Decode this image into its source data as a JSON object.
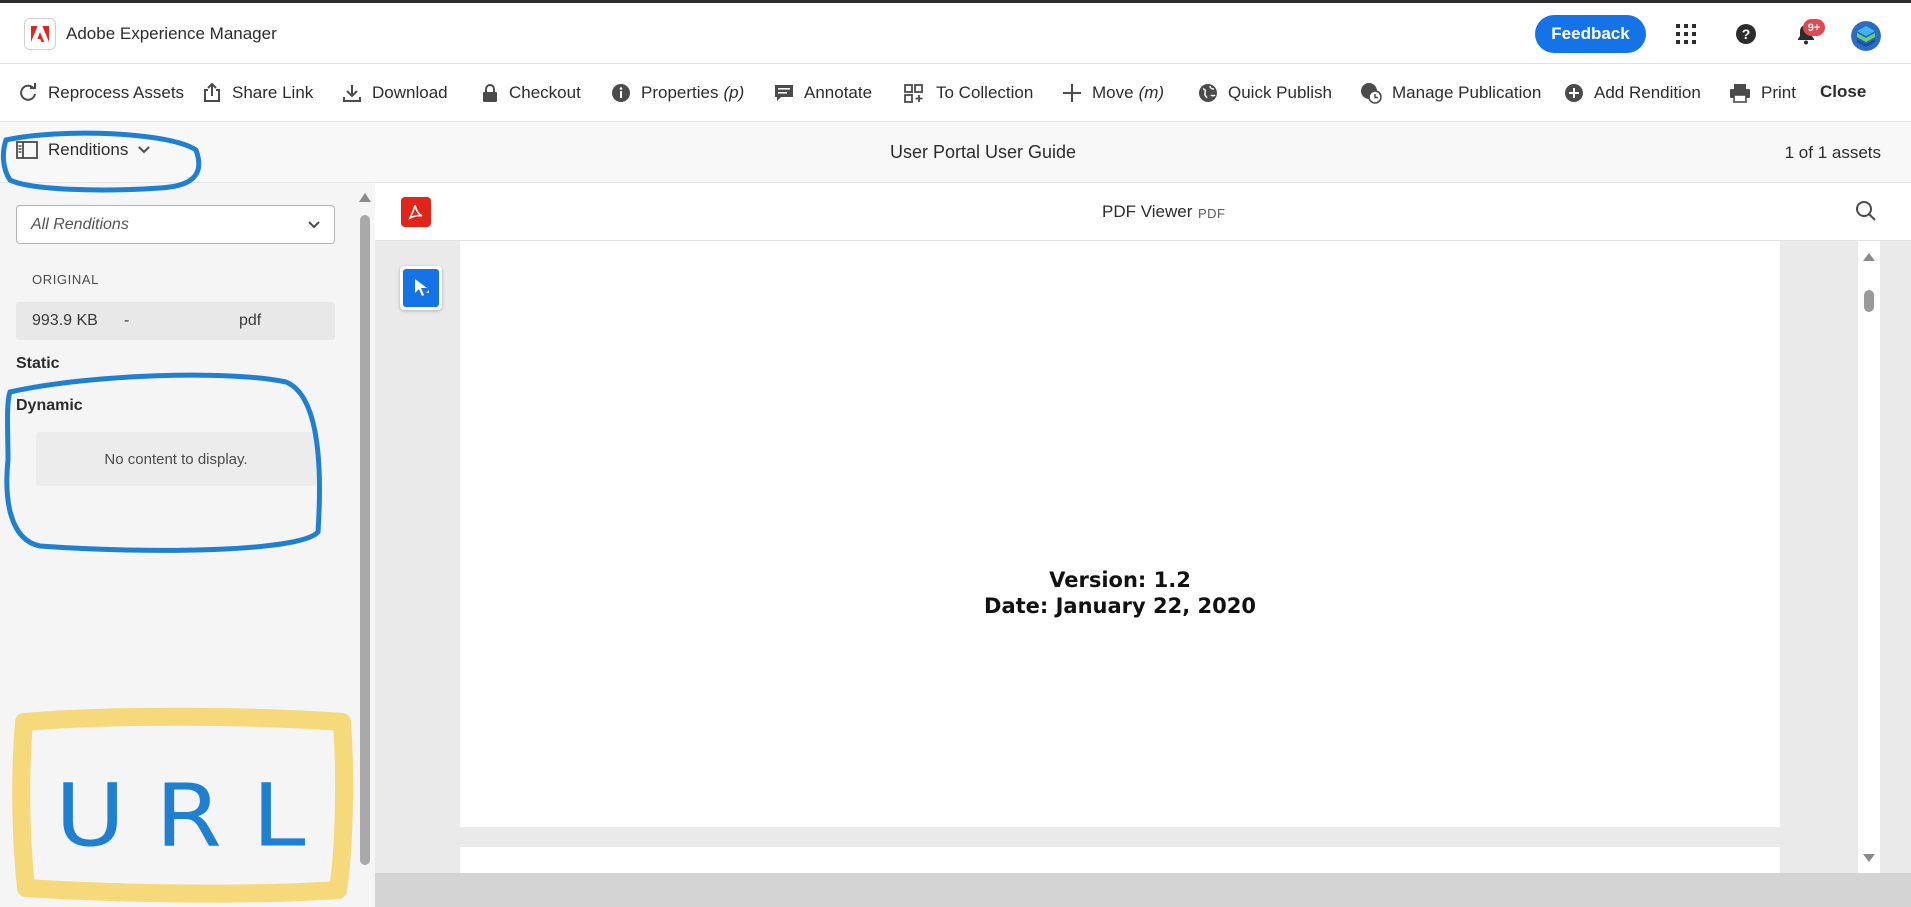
{
  "app": {
    "name": "Adobe Experience Manager",
    "feedback_label": "Feedback",
    "notification_count": "9+",
    "brand_color": "#1473e6"
  },
  "actions": {
    "reprocess": "Reprocess Assets",
    "share_link": "Share Link",
    "download": "Download",
    "checkout": "Checkout",
    "properties": "Properties",
    "properties_key": "(p)",
    "annotate": "Annotate",
    "to_collection": "To Collection",
    "move": "Move",
    "move_key": "(m)",
    "quick_publish": "Quick Publish",
    "manage_publication": "Manage Publication",
    "add_rendition": "Add Rendition",
    "print": "Print",
    "close": "Close"
  },
  "subheader": {
    "rail_label": "Renditions",
    "asset_title": "User Portal User Guide",
    "asset_count": "1 of 1 assets"
  },
  "renditions": {
    "filter_value": "All Renditions",
    "original_label": "ORIGINAL",
    "original": {
      "size": "993.9 KB",
      "dimensions": "-",
      "format": "pdf"
    },
    "static_label": "Static",
    "dynamic_label": "Dynamic",
    "dynamic_empty": "No content to display."
  },
  "viewer": {
    "title": "PDF Viewer",
    "type": "PDF",
    "page_lines": [
      "Version: 1.2",
      "Date: January 22, 2020"
    ]
  },
  "annotations": {
    "handwritten_text": "URL",
    "circle_color": "#1f7fd1",
    "highlight_color": "#f5d97a"
  }
}
